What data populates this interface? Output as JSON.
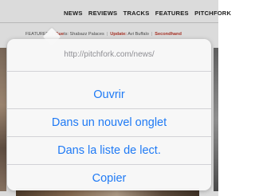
{
  "site": {
    "nav_items": [
      "NEWS",
      "REVIEWS",
      "TRACKS",
      "FEATURES",
      "PITCHFORK"
    ],
    "subnav": {
      "featured_label": "FEATURED",
      "guest_key": "Gue",
      "guest_rest": "ts: Shabazz Palaces",
      "update_key": "Update:",
      "update_value": "Avi Buffalo",
      "secondhand_key": "Secondhand"
    }
  },
  "action_sheet": {
    "title": "http://pitchfork.com/news/",
    "actions": [
      {
        "label": "Ouvrir"
      },
      {
        "label": "Dans un nouvel onglet"
      },
      {
        "label": "Dans la liste de lect."
      },
      {
        "label": "Copier"
      }
    ]
  },
  "colors": {
    "action_text": "#1f7af5",
    "title_text": "#8e8e93",
    "subnav_key": "#c0392b"
  }
}
